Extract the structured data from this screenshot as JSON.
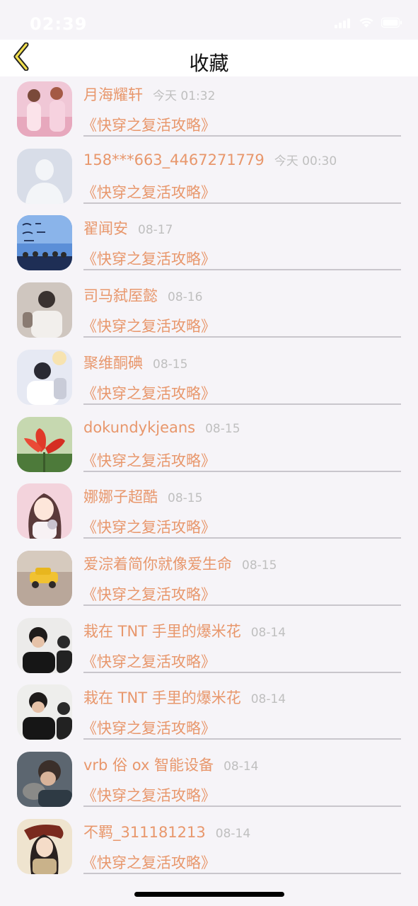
{
  "status_bar": {
    "time": "02:39"
  },
  "header": {
    "title": "收藏",
    "back_icon": "chevron-left-icon"
  },
  "accent_color": "#e8976c",
  "items": [
    {
      "name": "月海耀轩",
      "time": "今天 01:32",
      "book": "《快穿之复活攻略》",
      "avatar": "photo-two-people"
    },
    {
      "name": "158***663_4467271779",
      "time": "今天 00:30",
      "book": "《快穿之复活攻略》",
      "avatar": "default-user-silhouette"
    },
    {
      "name": "翟闻安",
      "time": "08-17",
      "book": "《快穿之复活攻略》",
      "avatar": "photo-group-poster"
    },
    {
      "name": "司马弑厔懿",
      "time": "08-16",
      "book": "《快穿之复活攻略》",
      "avatar": "photo-man-selfie"
    },
    {
      "name": "聚维酮碘",
      "time": "08-15",
      "book": "《快穿之复活攻略》",
      "avatar": "photo-person-hood"
    },
    {
      "name": "dokundykjeans",
      "time": "08-15",
      "book": "《快穿之复活攻略》",
      "avatar": "photo-red-flower"
    },
    {
      "name": "娜娜子超酷",
      "time": "08-15",
      "book": "《快穿之复活攻略》",
      "avatar": "illustration-girl"
    },
    {
      "name": "爱淙着简你就像爱生命",
      "time": "08-15",
      "book": "《快穿之复活攻略》",
      "avatar": "photo-toy-car"
    },
    {
      "name": "栽在 TNT 手里的爆米花",
      "time": "08-14",
      "book": "《快穿之复活攻略》",
      "avatar": "photo-boys"
    },
    {
      "name": "栽在 TNT 手里的爆米花",
      "time": "08-14",
      "book": "《快穿之复活攻略》",
      "avatar": "photo-boys"
    },
    {
      "name": "vrb 俗 ox 智能设备",
      "time": "08-14",
      "book": "《快穿之复活攻略》",
      "avatar": "photo-man-cat"
    },
    {
      "name": "不羁_311181213",
      "time": "08-14",
      "book": "《快穿之复活攻略》",
      "avatar": "illustration-warrior"
    }
  ]
}
